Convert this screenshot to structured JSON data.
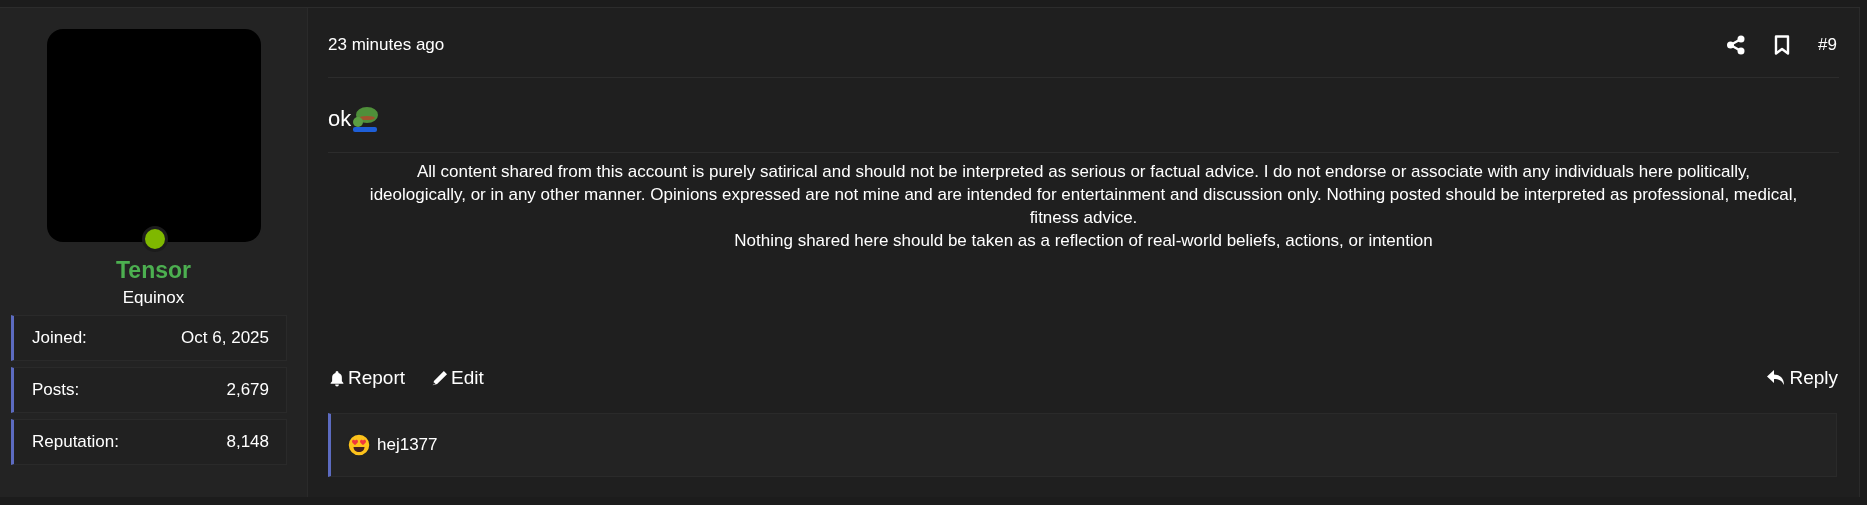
{
  "user": {
    "name": "Tensor",
    "title": "Equinox",
    "online": true,
    "stats": [
      {
        "label": "Joined:",
        "value": "Oct 6, 2025"
      },
      {
        "label": "Posts:",
        "value": "2,679"
      },
      {
        "label": "Reputation:",
        "value": "8,148"
      }
    ]
  },
  "post": {
    "time": "23 minutes ago",
    "number": "#9",
    "body": "ok",
    "signature": [
      "All content shared from this account is purely satirical and should not be interpreted as serious or factual advice. I do not endorse or associate with any individuals here politically, ideologically, or in any other manner. Opinions expressed are not mine and are intended for entertainment and discussion only. Nothing posted should be interpreted as professional, medical, fitness advice.",
      "Nothing shared here should be taken as a reflection of real-world beliefs, actions, or intention"
    ],
    "actions": [
      {
        "kind": "report",
        "label": "Report"
      },
      {
        "kind": "edit",
        "label": "Edit"
      }
    ],
    "reply": "Reply",
    "reactions": [
      {
        "user": "hej1377"
      }
    ]
  }
}
